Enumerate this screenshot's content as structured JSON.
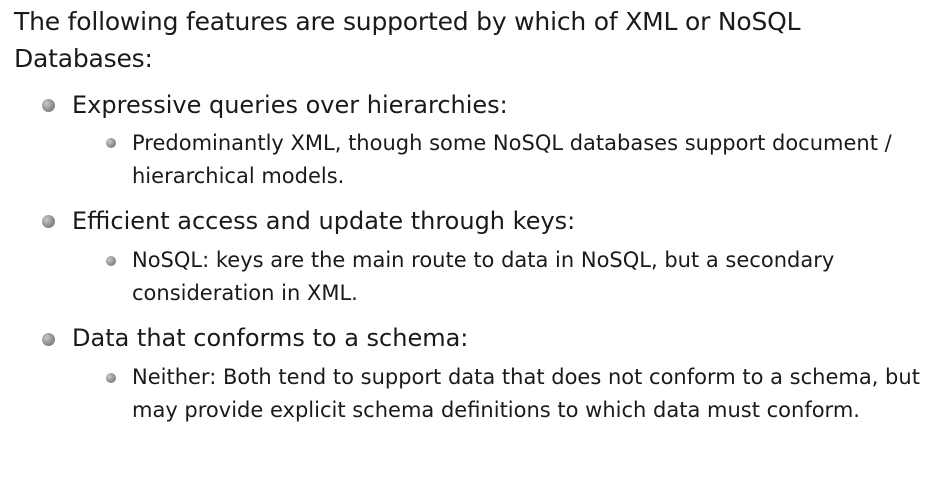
{
  "intro": "The following features are supported by which of XML or NoSQL Databases:",
  "items": [
    {
      "heading": "Expressive queries over hierarchies:",
      "detail": "Predominantly XML, though some NoSQL databases support document / hierarchical models."
    },
    {
      "heading": "Efficient access and update through keys:",
      "detail": "NoSQL: keys are the main route to data in NoSQL, but a secondary consideration in XML."
    },
    {
      "heading": "Data that conforms to a schema:",
      "detail": "Neither: Both tend to support data that does not conform to a schema, but may provide explicit schema definitions to which data must conform."
    }
  ]
}
